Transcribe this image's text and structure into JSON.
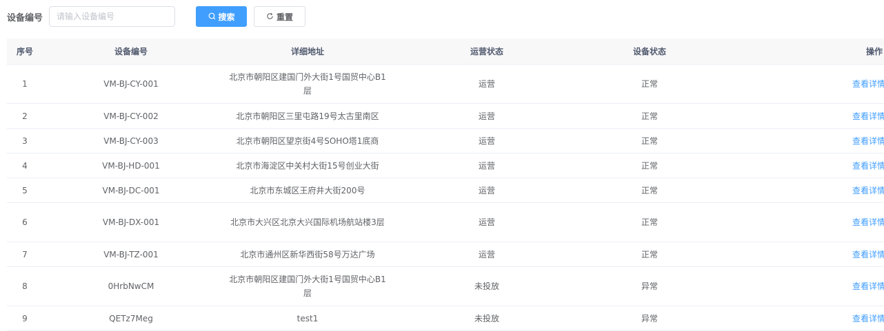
{
  "search": {
    "label": "设备编号",
    "placeholder": "请输入设备编号",
    "search_icon": "search-icon",
    "search_button": "搜索",
    "reset_icon": "refresh-icon",
    "reset_button": "重置"
  },
  "colors": {
    "primary": "#409eff",
    "header_bg": "#f8f8f9",
    "border": "#ebeef5",
    "text": "#606266"
  },
  "table": {
    "columns": [
      "序号",
      "设备编号",
      "详细地址",
      "运营状态",
      "设备状态",
      "操作"
    ],
    "rows": [
      {
        "seq": "1",
        "code": "VM-BJ-CY-001",
        "address": "北京市朝阳区建国门外大街1号国贸中心B1层",
        "op_status": "运营",
        "dev_status": "正常",
        "action": "查看详情"
      },
      {
        "seq": "2",
        "code": "VM-BJ-CY-002",
        "address": "北京市朝阳区三里屯路19号太古里南区",
        "op_status": "运营",
        "dev_status": "正常",
        "action": "查看详情"
      },
      {
        "seq": "3",
        "code": "VM-BJ-CY-003",
        "address": "北京市朝阳区望京街4号SOHO塔1底商",
        "op_status": "运营",
        "dev_status": "正常",
        "action": "查看详情"
      },
      {
        "seq": "4",
        "code": "VM-BJ-HD-001",
        "address": "北京市海淀区中关村大街15号创业大街",
        "op_status": "运营",
        "dev_status": "正常",
        "action": "查看详情"
      },
      {
        "seq": "5",
        "code": "VM-BJ-DC-001",
        "address": "北京市东城区王府井大街200号",
        "op_status": "运营",
        "dev_status": "正常",
        "action": "查看详情"
      },
      {
        "seq": "6",
        "code": "VM-BJ-DX-001",
        "address": "北京市大兴区北京大兴国际机场航站楼3层",
        "op_status": "运营",
        "dev_status": "正常",
        "action": "查看详情"
      },
      {
        "seq": "7",
        "code": "VM-BJ-TZ-001",
        "address": "北京市通州区新华西街58号万达广场",
        "op_status": "运营",
        "dev_status": "正常",
        "action": "查看详情"
      },
      {
        "seq": "8",
        "code": "0HrbNwCM",
        "address": "北京市朝阳区建国门外大街1号国贸中心B1层",
        "op_status": "未投放",
        "dev_status": "异常",
        "action": "查看详情"
      },
      {
        "seq": "9",
        "code": "QETz7Meg",
        "address": "test1",
        "op_status": "未投放",
        "dev_status": "异常",
        "action": "查看详情"
      }
    ]
  }
}
